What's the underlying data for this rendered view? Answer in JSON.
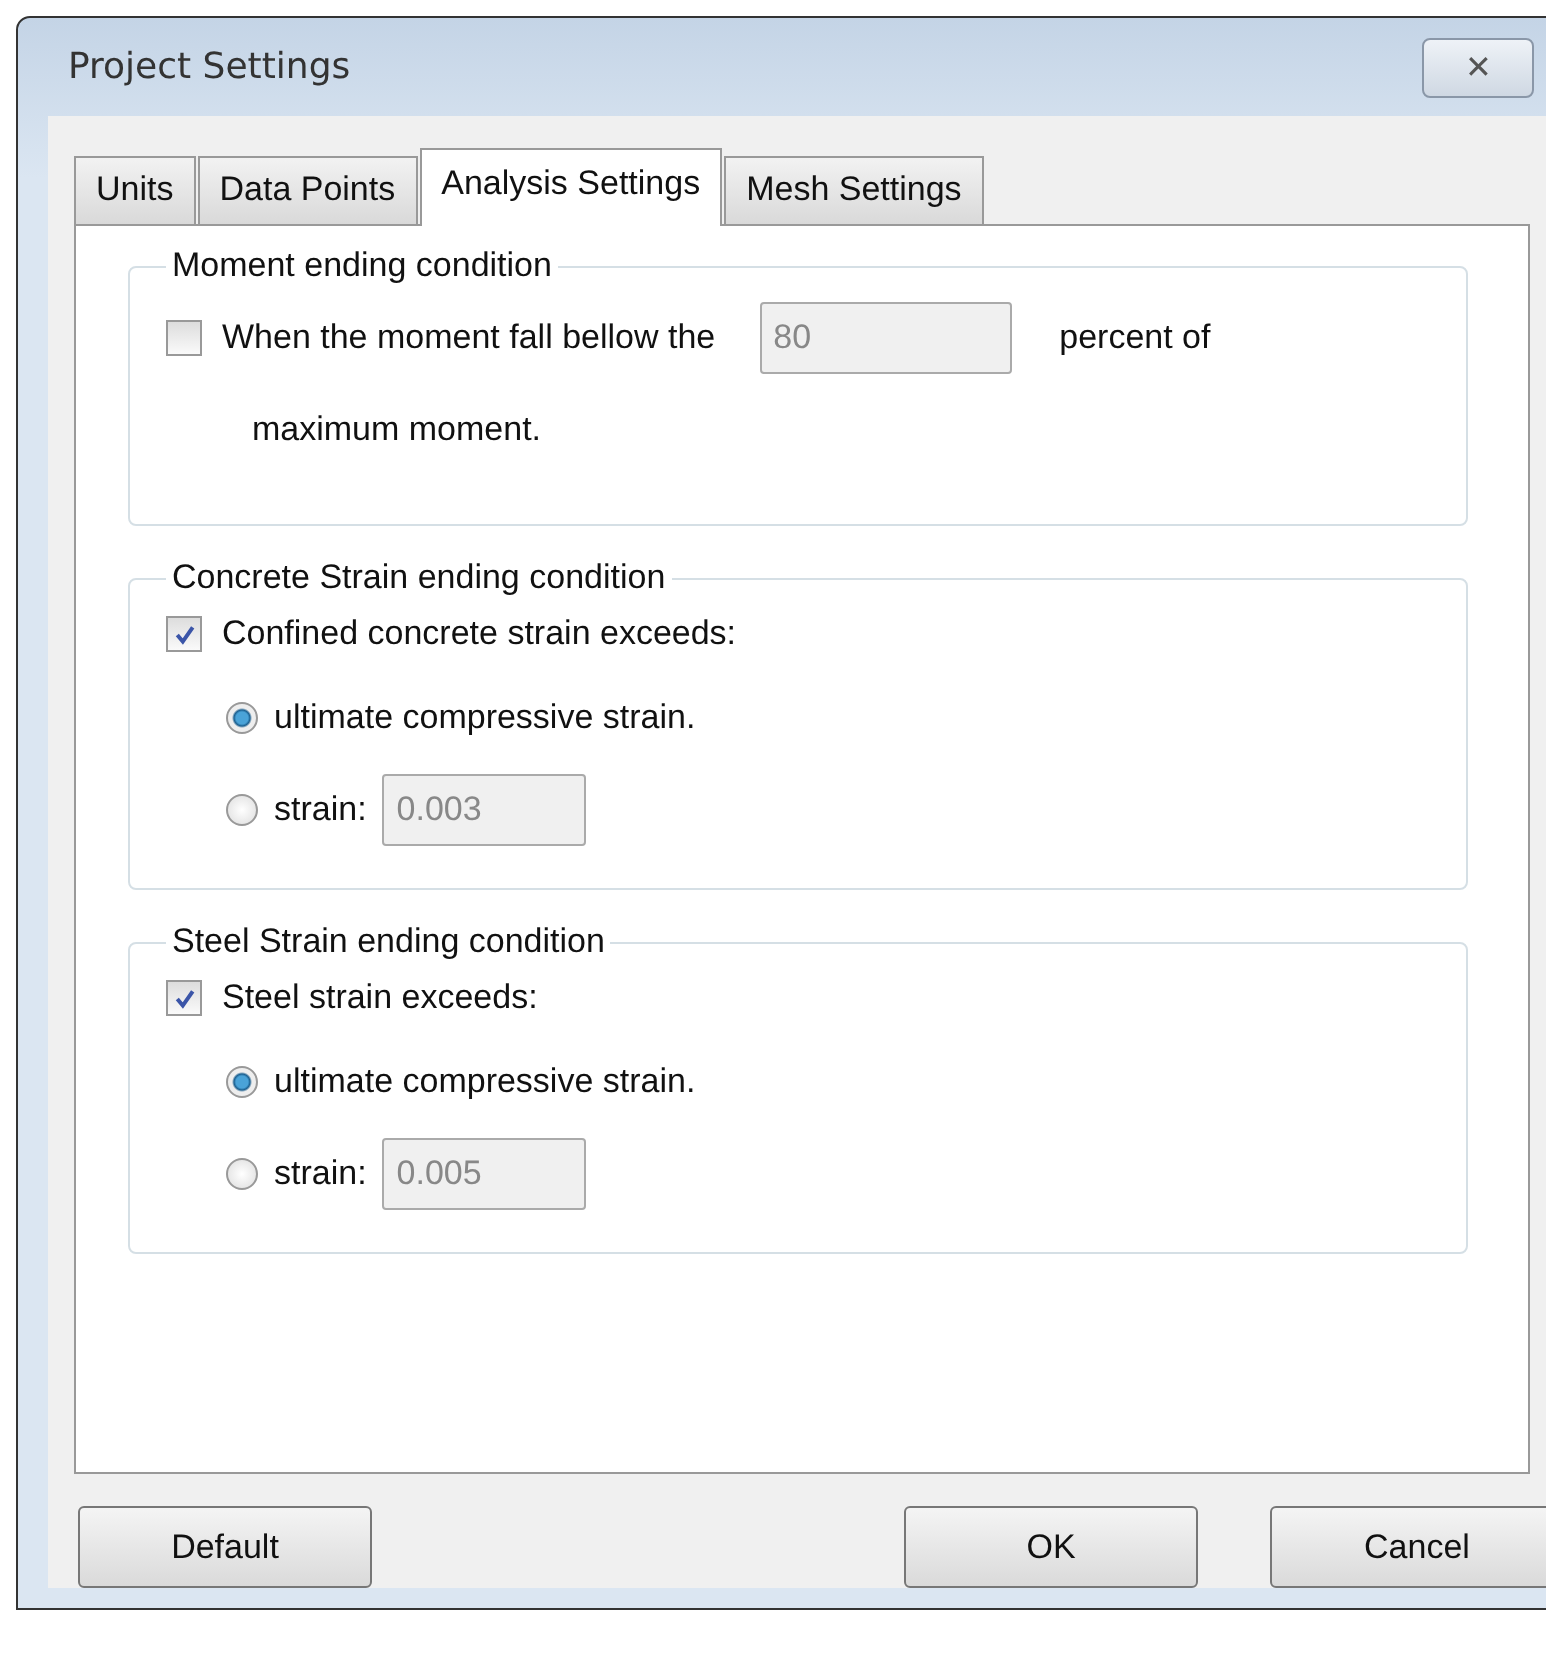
{
  "window": {
    "title": "Project Settings",
    "close": "✕"
  },
  "tabs": [
    {
      "label": "Units",
      "selected": false
    },
    {
      "label": "Data Points",
      "selected": false
    },
    {
      "label": "Analysis Settings",
      "selected": true
    },
    {
      "label": "Mesh Settings",
      "selected": false
    }
  ],
  "groups": [
    {
      "kind": "threshold",
      "title": "Moment ending condition",
      "checkbox": {
        "label": "When the moment fall bellow the",
        "checked": false
      },
      "value": "80",
      "suffix": "percent of",
      "continuation": "maximum moment."
    },
    {
      "kind": "strain",
      "title": "Concrete Strain ending condition",
      "checkbox": {
        "label": "Confined concrete strain exceeds:",
        "checked": true
      },
      "options": [
        {
          "label": "ultimate compressive strain.",
          "selected": true
        },
        {
          "label": "strain:",
          "selected": false,
          "value": "0.003"
        }
      ]
    },
    {
      "kind": "strain",
      "title": "Steel Strain ending condition",
      "checkbox": {
        "label": "Steel strain exceeds:",
        "checked": true
      },
      "options": [
        {
          "label": "ultimate compressive strain.",
          "selected": true
        },
        {
          "label": "strain:",
          "selected": false,
          "value": "0.005"
        }
      ]
    }
  ],
  "buttons": {
    "left": [
      "Default"
    ],
    "right": [
      "OK",
      "Cancel"
    ]
  }
}
